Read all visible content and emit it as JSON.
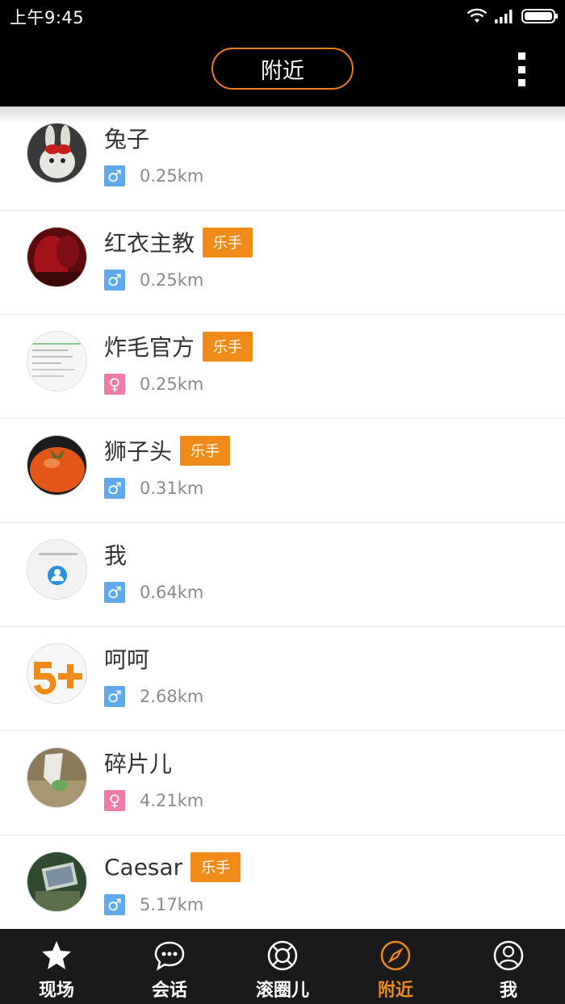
{
  "status_bar": {
    "time": "上午9:45"
  },
  "header": {
    "title": "附近"
  },
  "people": [
    {
      "name": "兔子",
      "badge": "",
      "gender": "male",
      "distance": "0.25km"
    },
    {
      "name": "红衣主教",
      "badge": "乐手",
      "gender": "male",
      "distance": "0.25km"
    },
    {
      "name": "炸毛官方",
      "badge": "乐手",
      "gender": "female",
      "distance": "0.25km"
    },
    {
      "name": "狮子头",
      "badge": "乐手",
      "gender": "male",
      "distance": "0.31km"
    },
    {
      "name": "我",
      "badge": "",
      "gender": "male",
      "distance": "0.64km"
    },
    {
      "name": "呵呵",
      "badge": "",
      "gender": "male",
      "distance": "2.68km"
    },
    {
      "name": "碎片儿",
      "badge": "",
      "gender": "female",
      "distance": "4.21km"
    },
    {
      "name": "Caesar",
      "badge": "乐手",
      "gender": "male",
      "distance": "5.17km"
    }
  ],
  "tabs": [
    {
      "label": "现场",
      "icon": "star-icon"
    },
    {
      "label": "会话",
      "icon": "chat-bubble-icon"
    },
    {
      "label": "滚圈儿",
      "icon": "lifebuoy-icon"
    },
    {
      "label": "附近",
      "icon": "compass-icon",
      "active": true
    },
    {
      "label": "我",
      "icon": "user-icon"
    }
  ],
  "colors": {
    "accent": "#f0881c",
    "male": "#5fa9ea",
    "female": "#f07aa6",
    "tabbar": "#1a1a1a"
  }
}
